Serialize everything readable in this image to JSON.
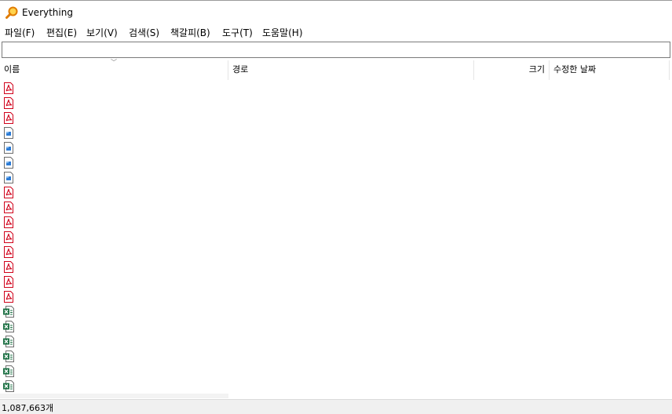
{
  "window": {
    "title": "Everything",
    "app_icon": "magnifier-icon"
  },
  "menu": [
    {
      "label": "파일(F)"
    },
    {
      "label": "편집(E)"
    },
    {
      "label": "보기(V)"
    },
    {
      "label": "검색(S)"
    },
    {
      "label": "책갈피(B)"
    },
    {
      "label": "도구(T)"
    },
    {
      "label": "도움말(H)"
    }
  ],
  "search": {
    "value": "",
    "placeholder": ""
  },
  "columns": [
    {
      "label": "이름",
      "sorted": "ascending"
    },
    {
      "label": "경로"
    },
    {
      "label": "크기"
    },
    {
      "label": "수정한 날짜"
    }
  ],
  "rows": [
    {
      "icon": "pdf-file-icon"
    },
    {
      "icon": "pdf-file-icon"
    },
    {
      "icon": "pdf-file-icon"
    },
    {
      "icon": "image-file-icon"
    },
    {
      "icon": "image-file-icon"
    },
    {
      "icon": "image-file-icon"
    },
    {
      "icon": "image-file-icon"
    },
    {
      "icon": "pdf-file-icon"
    },
    {
      "icon": "pdf-file-icon"
    },
    {
      "icon": "pdf-file-icon"
    },
    {
      "icon": "pdf-file-icon"
    },
    {
      "icon": "pdf-file-icon"
    },
    {
      "icon": "pdf-file-icon"
    },
    {
      "icon": "pdf-file-icon"
    },
    {
      "icon": "pdf-file-icon"
    },
    {
      "icon": "excel-file-icon"
    },
    {
      "icon": "excel-file-icon"
    },
    {
      "icon": "excel-file-icon"
    },
    {
      "icon": "excel-file-icon"
    },
    {
      "icon": "excel-file-icon"
    },
    {
      "icon": "excel-file-icon"
    }
  ],
  "status": {
    "count": "1,087,663개"
  },
  "colors": {
    "pdf": "#d0021b",
    "excel": "#1e7145",
    "image": "#2b7bd6",
    "title_icon": "#e07b00"
  }
}
